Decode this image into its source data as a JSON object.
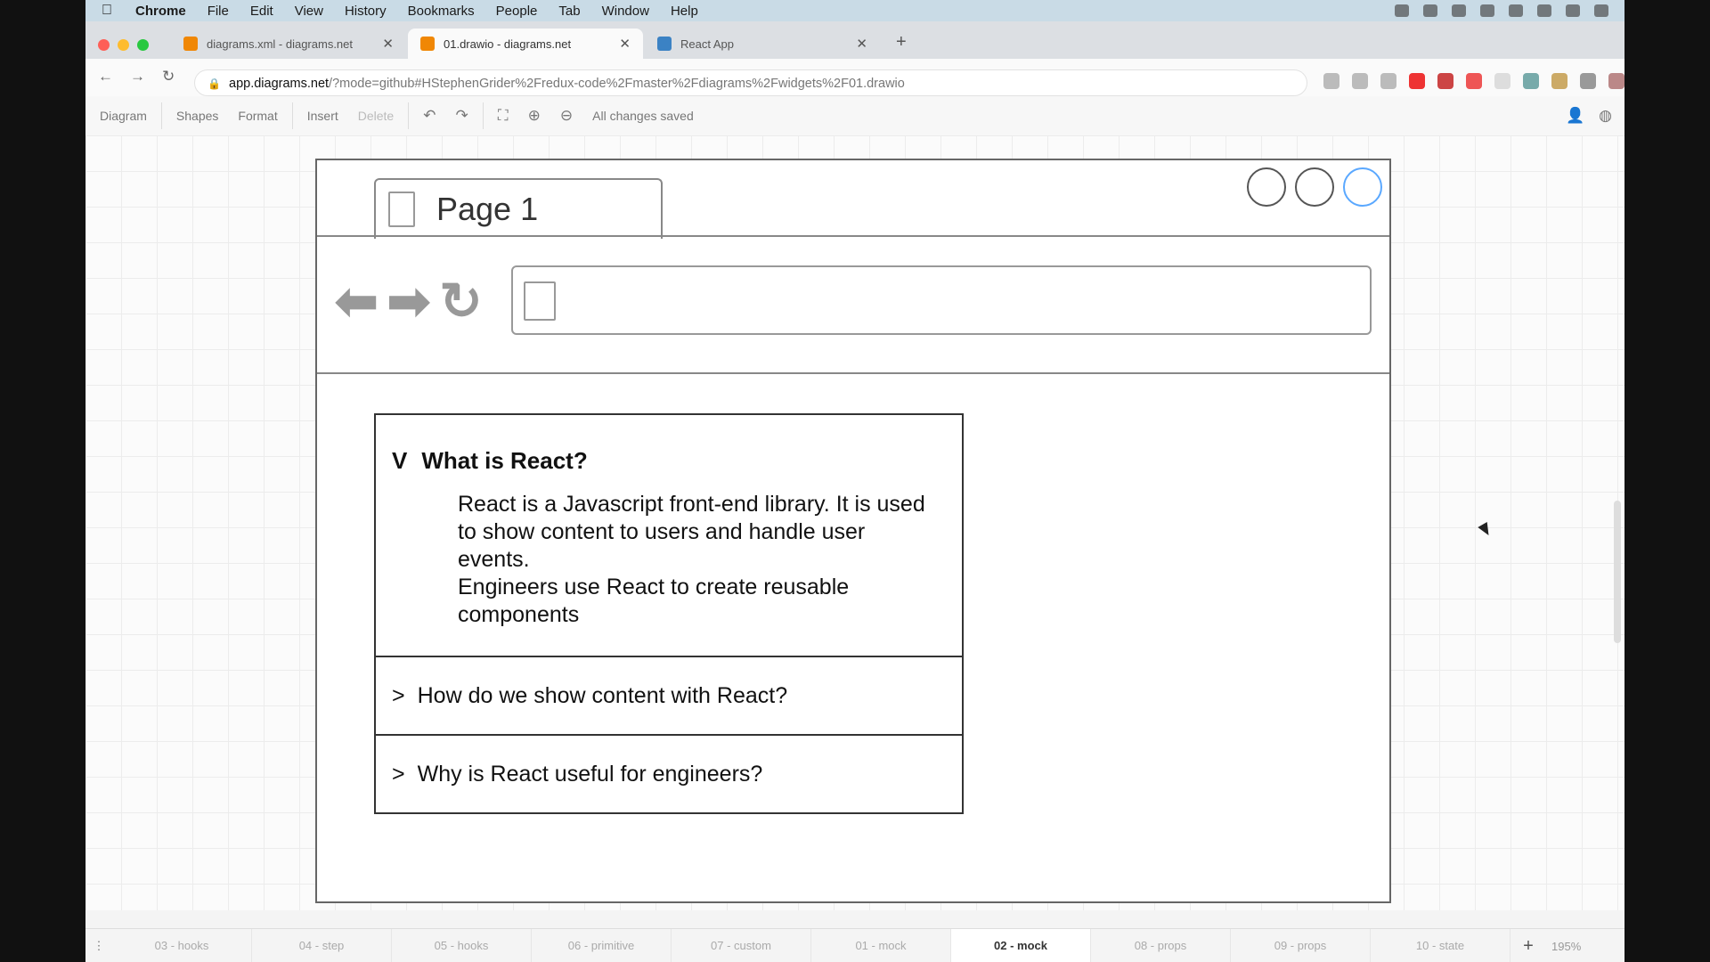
{
  "menubar": {
    "apple": "",
    "items": [
      "Chrome",
      "File",
      "Edit",
      "View",
      "History",
      "Bookmarks",
      "People",
      "Tab",
      "Window",
      "Help"
    ]
  },
  "tabs": [
    {
      "title": "diagrams.xml - diagrams.net",
      "favicon_color": "#f08705"
    },
    {
      "title": "01.drawio - diagrams.net",
      "favicon_color": "#f08705"
    },
    {
      "title": "React App",
      "favicon_color": "#3b82c4"
    }
  ],
  "address": {
    "host": "app.diagrams.net",
    "path": "/?mode=github#HStephenGrider%2Fredux-code%2Fmaster%2Fdiagrams%2Fwidgets%2F01.drawio"
  },
  "toolbar": {
    "diagram": "Diagram",
    "shapes": "Shapes",
    "format": "Format",
    "insert": "Insert",
    "delete": "Delete",
    "status": "All changes saved"
  },
  "mock": {
    "tab_label": "Page 1",
    "accordion": {
      "open_marker": "V",
      "closed_marker": ">",
      "items": [
        {
          "title": "What is React?",
          "body_lines": [
            "React is a Javascript front-end library. It is used",
            "to show content to users and handle user",
            "events.",
            "Engineers use React to create reusable",
            "components"
          ]
        },
        {
          "title": "How do we show content with React?"
        },
        {
          "title": "Why is React useful for engineers?"
        }
      ]
    }
  },
  "page_tabs": [
    "03 - hooks",
    "04 - step",
    "05 - hooks",
    "06 - primitive",
    "07 - custom",
    "01 - mock",
    "02 - mock",
    "08 - props",
    "09 - props",
    "10 - state"
  ],
  "active_page_tab": "02 - mock",
  "zoom": "195%"
}
